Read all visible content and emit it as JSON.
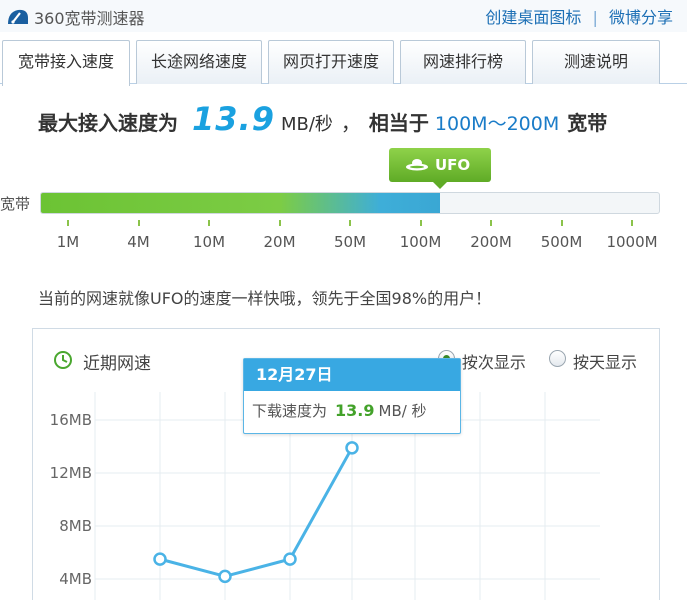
{
  "window": {
    "title": "360宽带测速器",
    "links": [
      "创建桌面图标",
      "微博分享"
    ],
    "link_separator": "|"
  },
  "tabs": [
    {
      "label": "宽带接入速度",
      "active": true
    },
    {
      "label": "长途网络速度",
      "active": false
    },
    {
      "label": "网页打开速度",
      "active": false
    },
    {
      "label": "网速排行榜",
      "active": false
    },
    {
      "label": "测速说明",
      "active": false
    }
  ],
  "headline": {
    "prefix": "最大接入速度为",
    "speed": "13.9",
    "unit": "MB/秒",
    "comma": "，",
    "equiv": "相当于",
    "range": "100M～200M",
    "suffix": "宽带"
  },
  "speed_meter": {
    "badge_label": "UFO",
    "bar_label": "宽带",
    "fill_fraction": 0.645,
    "ticks": [
      "1M",
      "4M",
      "10M",
      "20M",
      "50M",
      "100M",
      "200M",
      "500M",
      "1000M"
    ],
    "colors": {
      "green": "#6cc334",
      "blue": "#3aa7d4"
    }
  },
  "status_text": "当前的网速就像UFO的速度一样快哦，领先于全国98%的用户！",
  "panel": {
    "title": "近期网速",
    "radio_options": [
      {
        "label": "按次显示",
        "selected": true
      },
      {
        "label": "按天显示",
        "selected": false
      }
    ]
  },
  "tooltip": {
    "date": "12月27日",
    "label": "下载速度为",
    "value": "13.9",
    "unit": "MB/ 秒"
  },
  "chart_data": {
    "type": "line",
    "yticks": [
      "16MB",
      "12MB",
      "8MB",
      "4MB"
    ],
    "ytick_values": [
      16,
      12,
      8,
      4
    ],
    "ylim": [
      0,
      18
    ],
    "grid": true,
    "series": [
      {
        "values": [
          5.5,
          4.2,
          5.5,
          13.9
        ]
      }
    ],
    "color": "#4ab3e6"
  }
}
